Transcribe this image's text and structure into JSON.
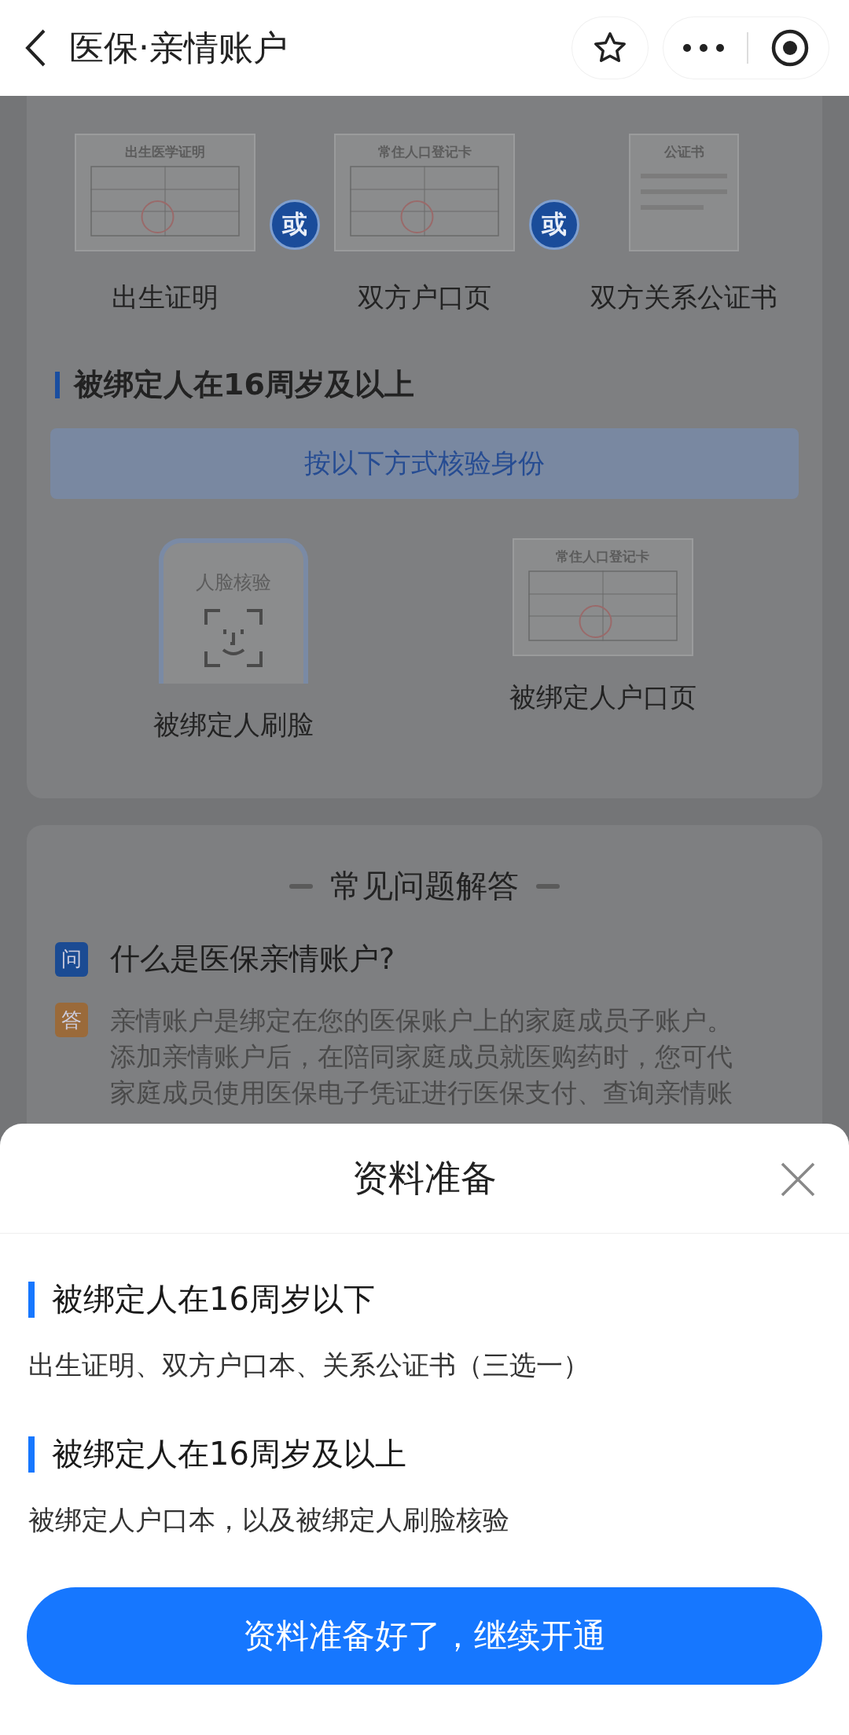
{
  "nav": {
    "title": "医保·亲情账户"
  },
  "under16_docs": {
    "items": [
      {
        "kind": "birth",
        "doc_title": "出生医学证明",
        "label": "出生证明"
      },
      {
        "kind": "household",
        "doc_title": "常住人口登记卡",
        "label": "双方户口页"
      },
      {
        "kind": "notary",
        "doc_title": "公证书",
        "label": "双方关系公证书"
      }
    ],
    "separators": [
      "或",
      "或"
    ]
  },
  "over16": {
    "heading": "被绑定人在16周岁及以上",
    "banner": "按以下方式核验身份",
    "methods": [
      {
        "kind": "face",
        "caption": "人脸核验",
        "label": "被绑定人刷脸"
      },
      {
        "kind": "household",
        "doc_title": "常住人口登记卡",
        "label": "被绑定人户口页"
      }
    ]
  },
  "faq": {
    "title": "常见问题解答",
    "q_badge": "问",
    "question": "什么是医保亲情账户?",
    "a_badge": "答",
    "answer_lines": [
      "亲情账户是绑定在您的医保账户上的家庭成员子账户。",
      "添加亲情账户后，在陪同家庭成员就医购药时，您可代",
      "家庭成员使用医保电子凭证进行医保支付、查询亲情账"
    ]
  },
  "sheet": {
    "title": "资料准备",
    "sections": [
      {
        "heading": "被绑定人在16周岁以下",
        "text": "出生证明、双方户口本、关系公证书（三选一）"
      },
      {
        "heading": "被绑定人在16周岁及以上",
        "text": "被绑定人户口本，以及被绑定人刷脸核验"
      }
    ],
    "button": "资料准备好了，继续开通"
  }
}
